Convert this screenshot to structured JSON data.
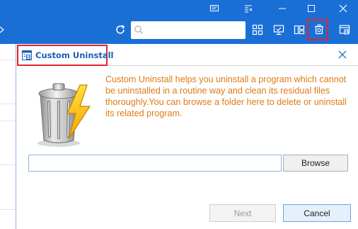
{
  "window": {
    "accent_color": "#1a6fd6",
    "controls": [
      {
        "name": "feedback-icon"
      },
      {
        "name": "menu-icon"
      },
      {
        "name": "minimize-icon"
      },
      {
        "name": "maximize-icon"
      },
      {
        "name": "close-icon"
      }
    ]
  },
  "toolbar": {
    "search": {
      "value": "",
      "placeholder": ""
    },
    "icons": [
      "refresh-icon",
      "search-icon",
      "grid-view-icon",
      "monitor-icon",
      "windows-apps-icon",
      "custom-uninstall-icon",
      "uninstall-icon"
    ]
  },
  "dialog": {
    "title": "Custom Uninstall",
    "description": "Custom Uninstall helps you uninstall a program which cannot be uninstalled in a routine way and clean its residual files thoroughly.You can browse a folder here to delete or uninstall its related program.",
    "path": {
      "value": "",
      "placeholder": ""
    },
    "browse_label": "Browse",
    "next_label": "Next",
    "cancel_label": "Cancel",
    "desc_color": "#e07a16",
    "title_color": "#1a5fb4"
  }
}
